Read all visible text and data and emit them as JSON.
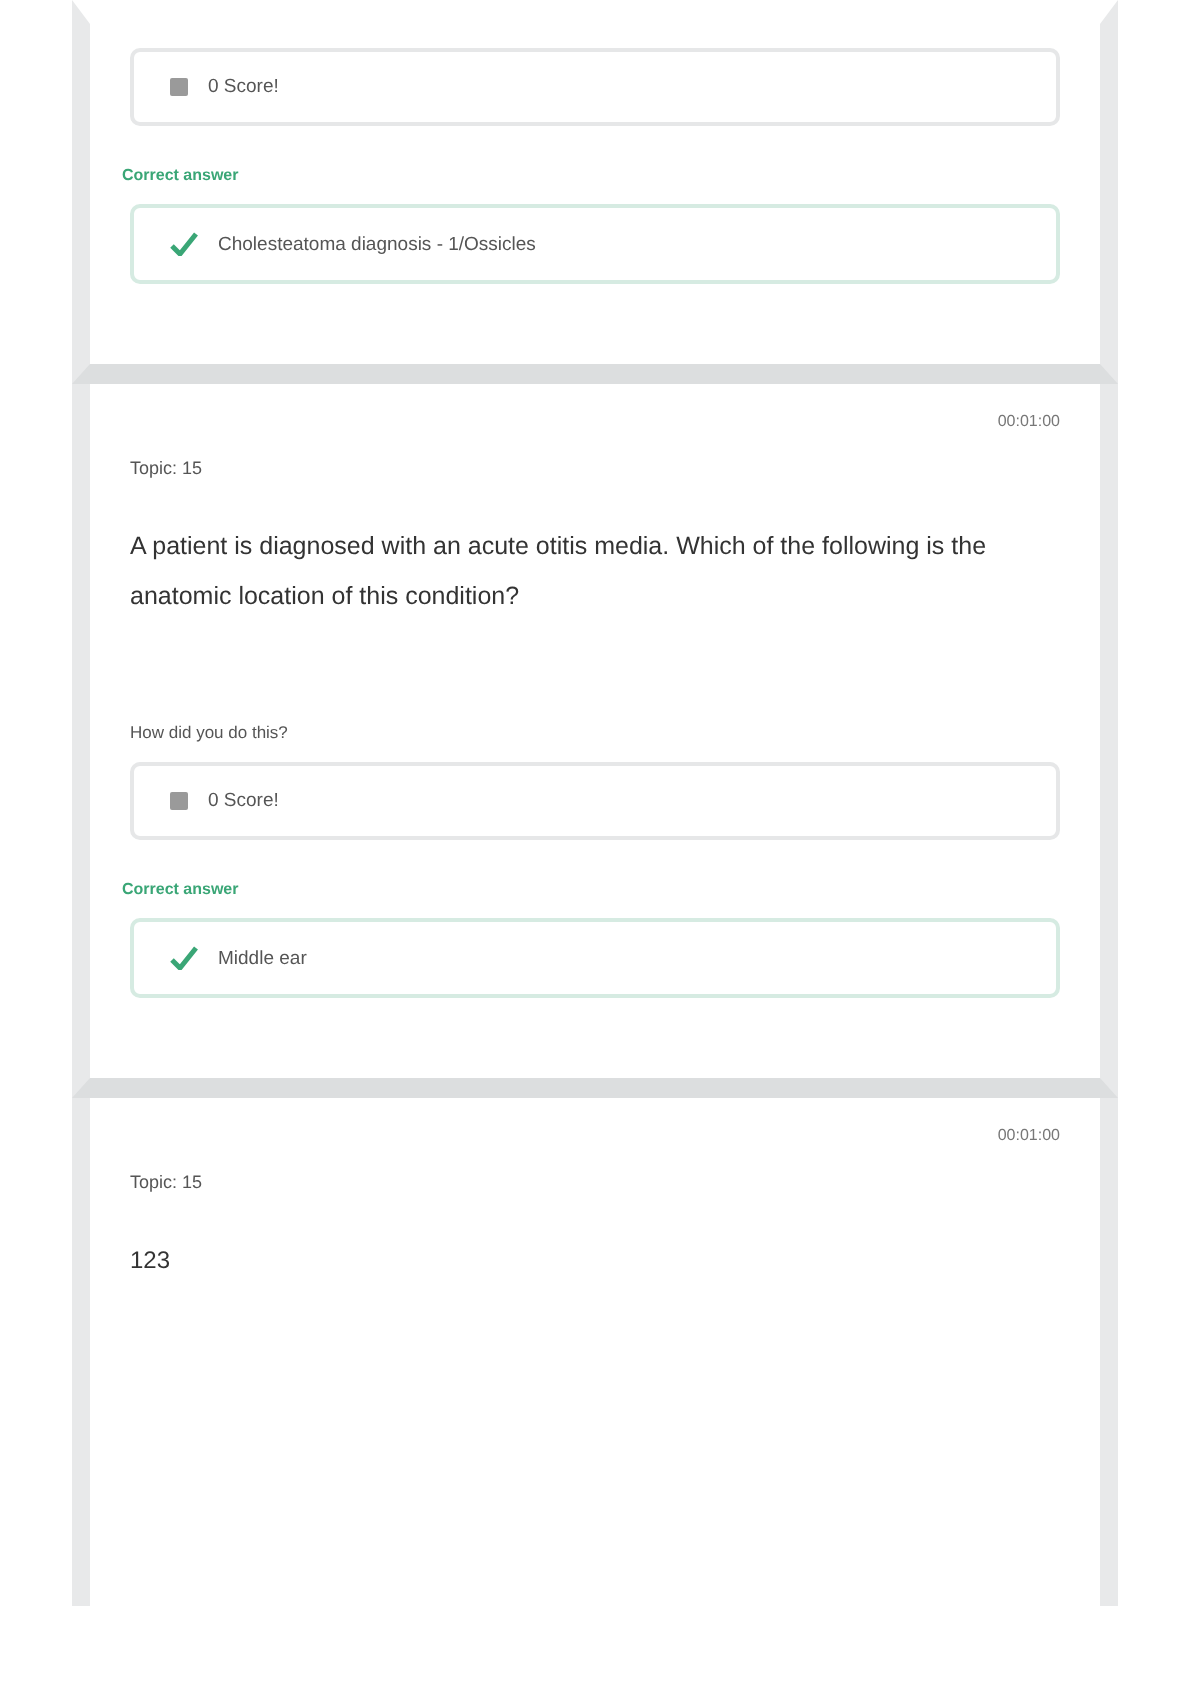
{
  "cards": [
    {
      "user_answer": "0 Score!",
      "correct_label": "Correct answer",
      "correct_answer": "Cholesteatoma diagnosis - 1/Ossicles"
    },
    {
      "timestamp": "00:01:00",
      "topic": "Topic: 15",
      "question": "A patient is diagnosed with an acute otitis media. Which of the following is the anatomic location of this condition?",
      "answer_label": "How did you do this?",
      "user_answer": "0 Score!",
      "correct_label": "Correct answer",
      "correct_answer": "Middle ear"
    },
    {
      "timestamp": "00:01:00",
      "topic": "Topic: 15",
      "question": "123"
    }
  ]
}
